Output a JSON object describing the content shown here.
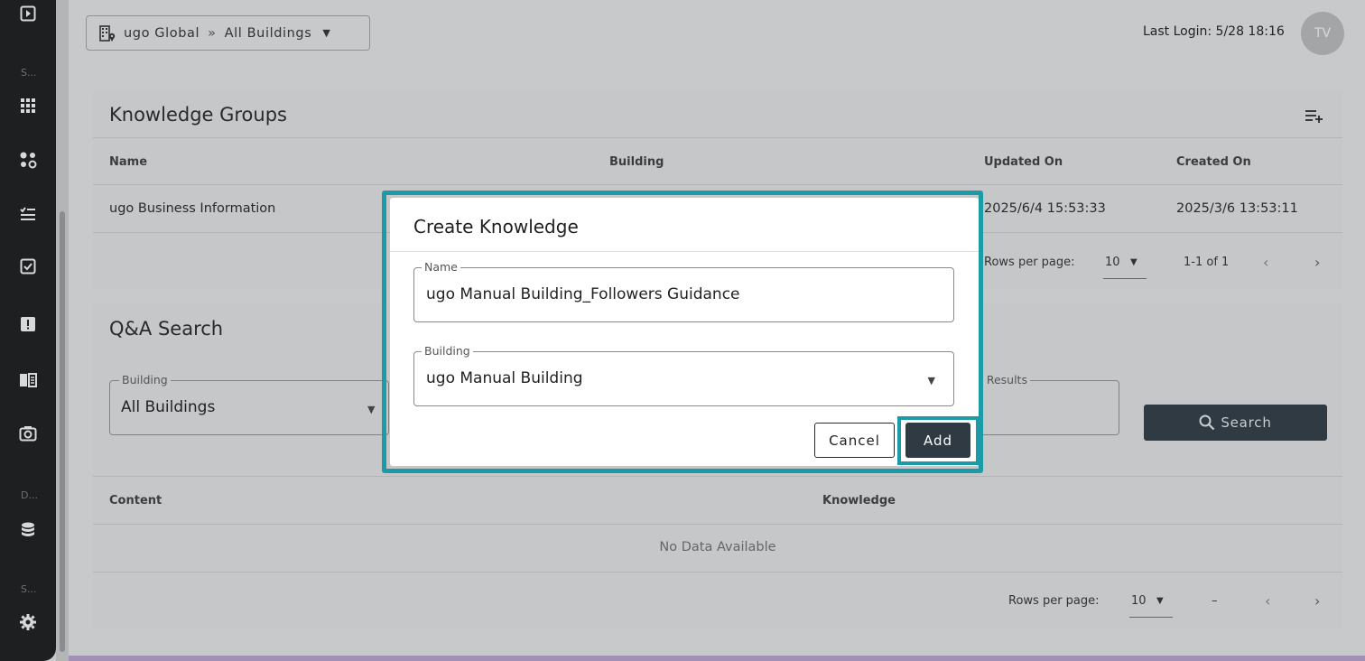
{
  "sidebar": {
    "sections": [
      "S...",
      "D...",
      "S..."
    ],
    "icons": [
      "play-box-icon",
      "apps-grid-icon",
      "hub-icon",
      "checklist-icon",
      "task-check-icon",
      "alert-icon",
      "manual-book-icon",
      "camera-icon",
      "database-icon",
      "settings-gear-icon"
    ]
  },
  "header": {
    "org": "ugo Global",
    "separator": "»",
    "scope": "All Buildings",
    "last_login": "Last Login: 5/28 18:16",
    "avatar_initials": "TV"
  },
  "knowledge_groups": {
    "title": "Knowledge Groups",
    "columns": [
      "Name",
      "Building",
      "Updated On",
      "Created On"
    ],
    "rows": [
      {
        "name": "ugo Business Information",
        "building": "",
        "updated_on": "2025/6/4 15:53:33",
        "created_on": "2025/3/6 13:53:11"
      }
    ],
    "rows_per_page_label": "Rows per page:",
    "rows_per_page": "10",
    "range": "1-1 of 1"
  },
  "qa_search": {
    "title": "Q&A Search",
    "building_label": "Building",
    "building_value": "All Buildings",
    "results_label": "er of Results",
    "search_button": "Search",
    "columns": [
      "Content",
      "Knowledge"
    ],
    "empty_text": "No Data Available",
    "rows_per_page_label": "Rows per page:",
    "rows_per_page": "10",
    "range": "–"
  },
  "modal": {
    "title": "Create Knowledge",
    "name_label": "Name",
    "name_value": "ugo Manual Building_Followers Guidance",
    "building_label": "Building",
    "building_value": "ugo Manual Building",
    "cancel_label": "Cancel",
    "add_label": "Add"
  },
  "colors": {
    "sidebar": "#1d1f21",
    "highlight": "#1b9aa8",
    "primary_button": "#2f3a42"
  }
}
